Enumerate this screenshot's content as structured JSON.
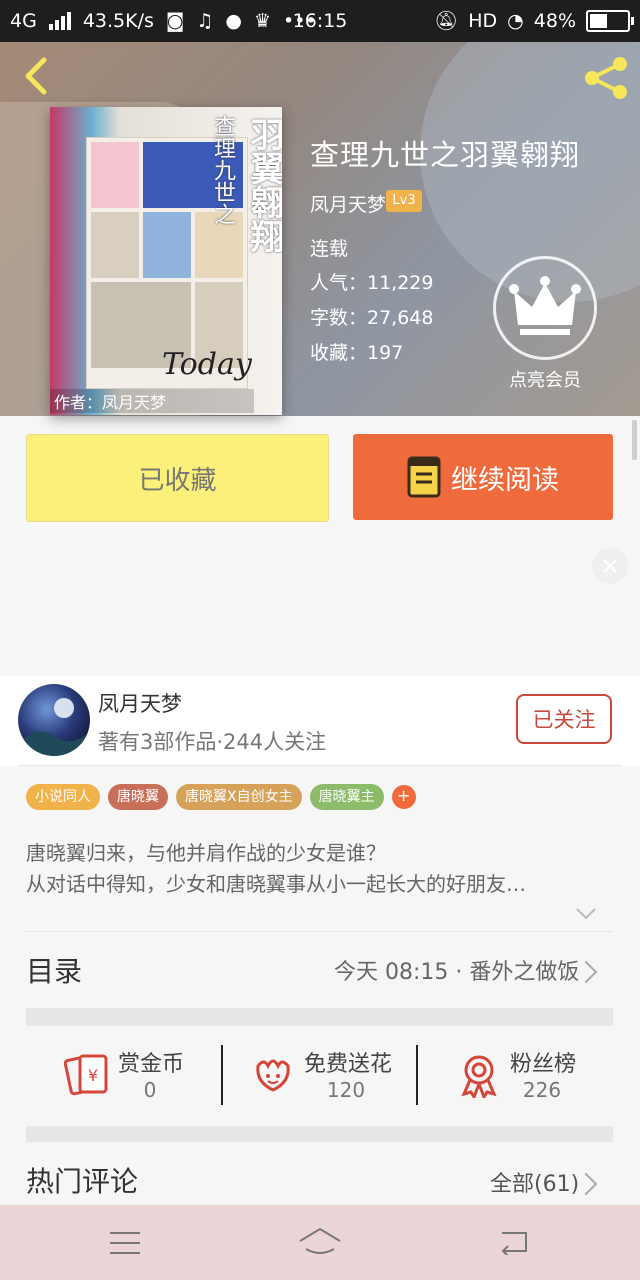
{
  "status_bar": {
    "network": "4G",
    "speed": "43.5K/s",
    "time": "16:15",
    "hd": "HD",
    "battery_text": "48%",
    "battery_level": 0.48
  },
  "book": {
    "title": "查理九世之羽翼翱翔",
    "author": "凤月天梦",
    "level": "Lv3",
    "status": "连载",
    "popularity": "人气：11,229",
    "word_count": "字数：27,648",
    "favorites": "收藏：197",
    "cover_title": "羽翼翱翔",
    "cover_subtitle": "查理九世之",
    "cover_byline": "作者：凤月天梦",
    "cover_today": "Today"
  },
  "vip": {
    "label": "点亮会员"
  },
  "actions": {
    "favorited": "已收藏",
    "continue_reading": "继续阅读"
  },
  "author_card": {
    "name": "凤月天梦",
    "meta": "著有3部作品·244人关注",
    "follow": "已关注"
  },
  "tags": [
    {
      "label": "小说同人",
      "color": "#f2b24a"
    },
    {
      "label": "唐晓翼",
      "color": "#c86f5a"
    },
    {
      "label": "唐晓翼X自创女主",
      "color": "#d6a25a"
    },
    {
      "label": "唐晓翼主",
      "color": "#8cbc6a"
    }
  ],
  "tag_more": "+",
  "synopsis": {
    "line1": "唐晓翼归来，与他并肩作战的少女是谁？",
    "line2": "从对话中得知，少女和唐晓翼事从小一起长大的好朋友…"
  },
  "toc": {
    "label": "目录",
    "latest": "今天 08:15 · 番外之做饭"
  },
  "rewards": [
    {
      "title": "赏金币",
      "count": "0",
      "icon": "red-envelope-icon"
    },
    {
      "title": "免费送花",
      "count": "120",
      "icon": "flower-icon"
    },
    {
      "title": "粉丝榜",
      "count": "226",
      "icon": "medal-icon"
    }
  ],
  "comments": {
    "label": "热门评论",
    "all": "全部(61)"
  },
  "colors": {
    "accent_orange": "#ef6b3c",
    "fav_yellow": "#fbf07a",
    "follow_red": "#c9473b",
    "icon_red": "#d4463a"
  }
}
